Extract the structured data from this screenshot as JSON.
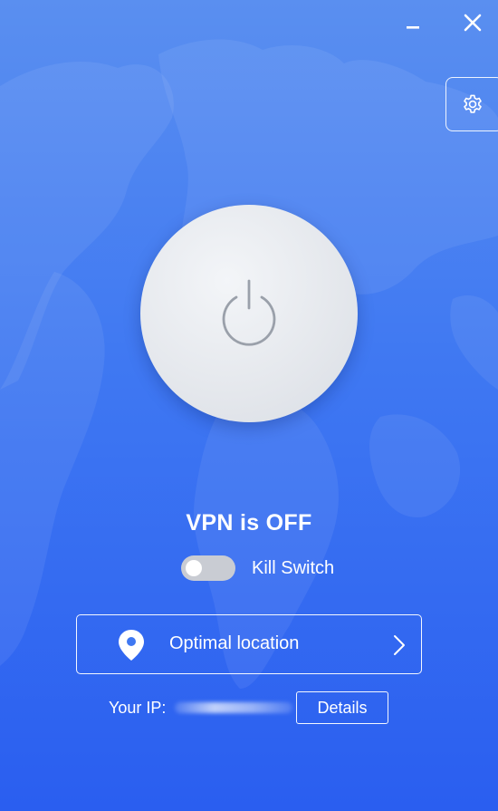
{
  "window": {
    "minimize_icon": "minimize-icon",
    "close_icon": "close-icon"
  },
  "settings": {
    "icon": "gear-icon"
  },
  "power": {
    "icon": "power-icon"
  },
  "status": {
    "text": "VPN is OFF"
  },
  "kill_switch": {
    "label": "Kill Switch",
    "enabled": false
  },
  "location": {
    "label": "Optimal location",
    "icon": "location-pin-icon",
    "chevron": "chevron-right-icon"
  },
  "ip": {
    "label": "Your IP:",
    "details_label": "Details"
  },
  "colors": {
    "background_top": "#5a8ff0",
    "background_bottom": "#2a5ef0",
    "power_button": "#e4e7ec",
    "power_icon": "#9aa0aa",
    "toggle_off": "#c9ccd3"
  }
}
